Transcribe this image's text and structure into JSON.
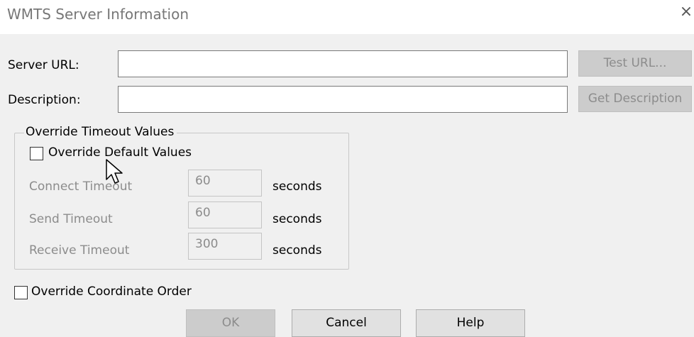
{
  "window": {
    "title": "WMTS Server Information",
    "close_glyph": "×"
  },
  "server_url": {
    "label": "Server URL:",
    "value": "",
    "button": "Test URL..."
  },
  "description": {
    "label": "Description:",
    "value": "",
    "button": "Get Description"
  },
  "timeout_group": {
    "legend": "Override Timeout Values",
    "override_checkbox_label": "Override Default Values",
    "override_checked": false,
    "unit": "seconds",
    "rows": [
      {
        "label": "Connect Timeout",
        "value": "60",
        "unit": "seconds"
      },
      {
        "label": "Send Timeout",
        "value": "60",
        "unit": "seconds"
      },
      {
        "label": "Receive Timeout",
        "value": "300",
        "unit": "seconds"
      }
    ]
  },
  "coordinate_order": {
    "label": "Override Coordinate Order",
    "checked": false
  },
  "buttons": {
    "ok": "OK",
    "cancel": "Cancel",
    "help": "Help"
  },
  "colors": {
    "background": "#f0f0f0",
    "disabled_text": "#8c8c8c",
    "title_text": "#777777"
  },
  "icons": {
    "close": "close-icon",
    "cursor": "mouse-pointer-icon"
  }
}
